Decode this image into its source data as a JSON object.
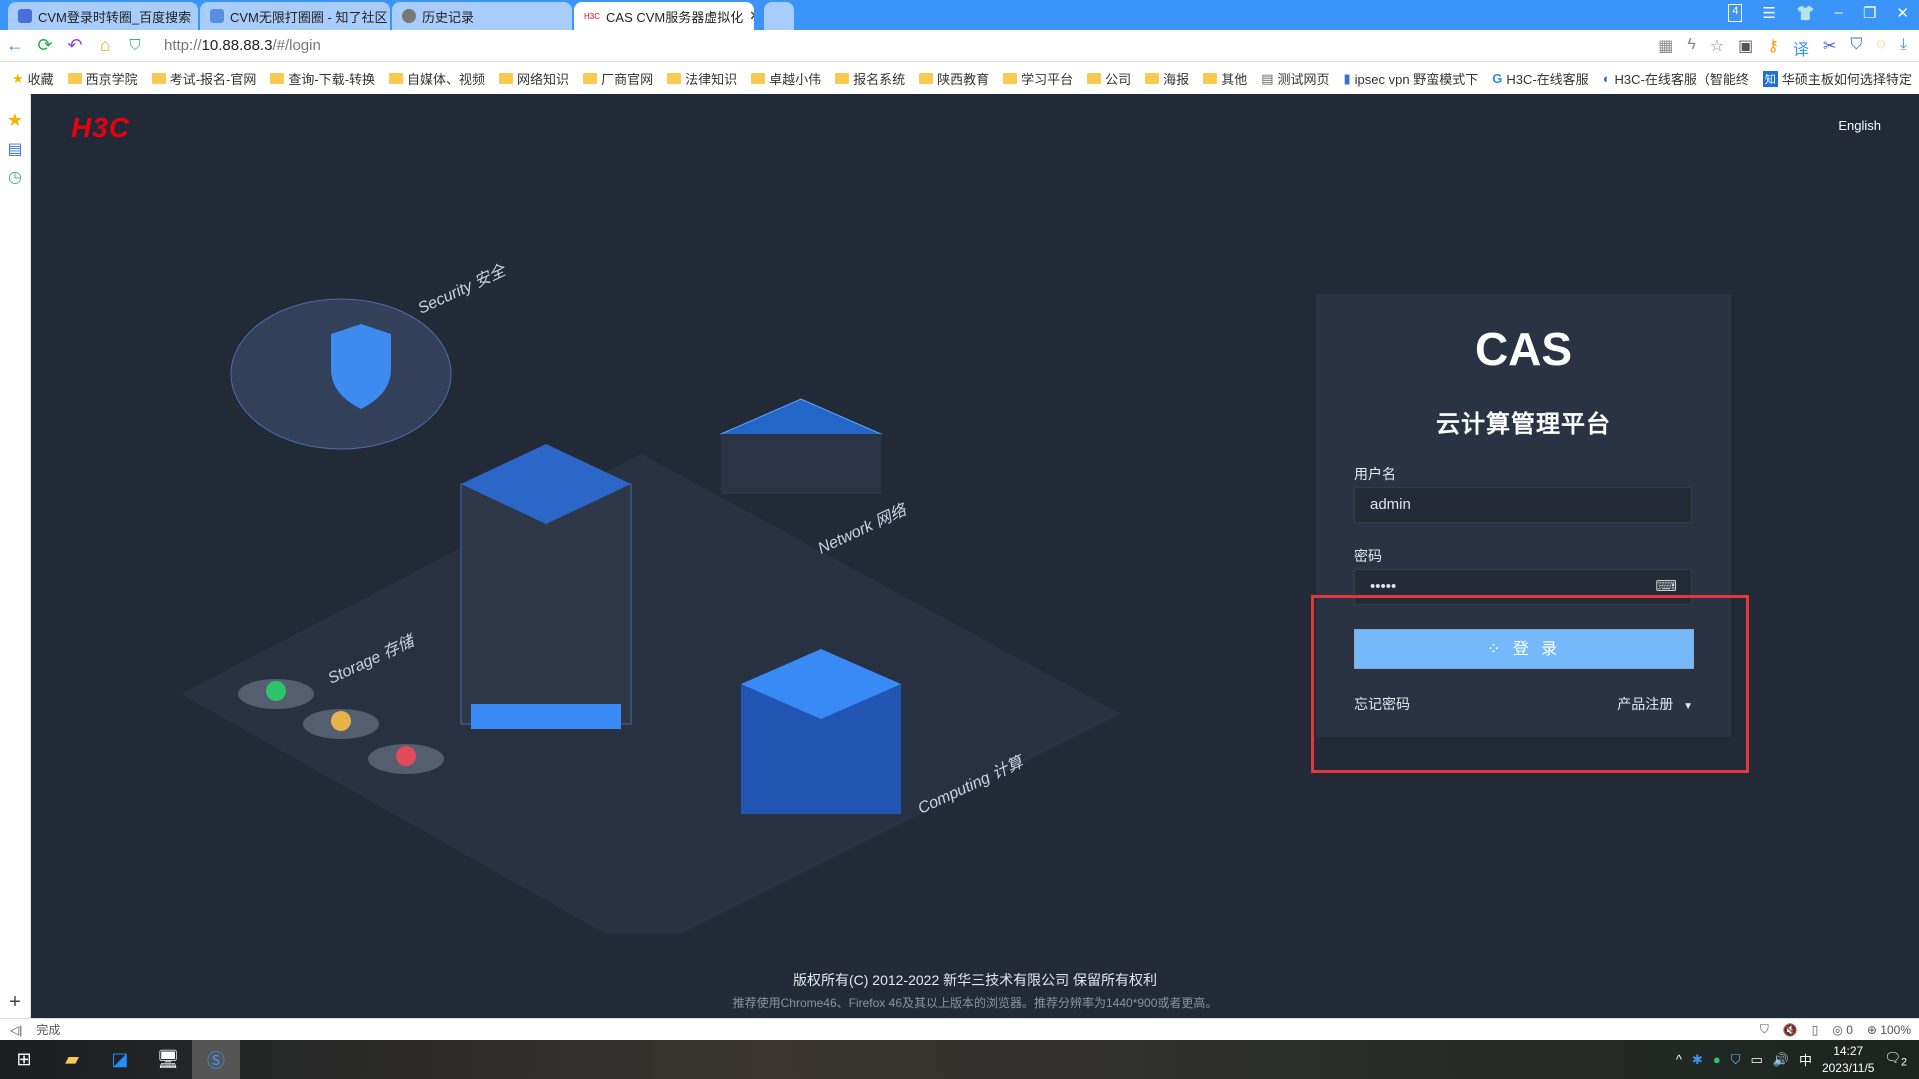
{
  "browser": {
    "tabs": [
      {
        "label": "CVM登录时转圈_百度搜索"
      },
      {
        "label": "CVM无限打圈圈 - 知了社区"
      },
      {
        "label": "历史记录"
      },
      {
        "label": "CAS CVM服务器虚拟化",
        "active": true
      }
    ],
    "tab_count": "4",
    "url_prefix": "http://",
    "url_host": "10.88.88.3",
    "url_path": "/#/login",
    "bookmarks": [
      "收藏",
      "西京学院",
      "考试-报名-官网",
      "查询-下载-转换",
      "自媒体、视频",
      "网络知识",
      "厂商官网",
      "法律知识",
      "卓越小伟",
      "报名系统",
      "陕西教育",
      "学习平台",
      "公司",
      "海报",
      "其他",
      "测试网页",
      "ipsec vpn 野蛮模式下",
      "H3C-在线客服",
      "H3C-在线客服（智能终",
      "华硕主板如何选择特定"
    ],
    "status_text": "完成",
    "status_count": "0",
    "zoom": "100%"
  },
  "page": {
    "logo": "H3C",
    "language_link": "English",
    "illustration_labels": [
      "Security 安全",
      "Network 网络",
      "Storage 存储",
      "Computing 计算"
    ],
    "login": {
      "product_logo": "CAS",
      "product_title": "云计算管理平台",
      "username_label": "用户名",
      "username_value": "admin",
      "password_label": "密码",
      "password_value": "•••••",
      "login_button": "登 录",
      "forgot_password": "忘记密码",
      "product_register": "产品注册"
    },
    "footer": {
      "copyright": "版权所有(C) 2012-2022 新华三技术有限公司 保留所有权利",
      "browser_hint": "推荐使用Chrome46、Firefox 46及其以上版本的浏览器。推荐分辨率为1440*900或者更高。"
    }
  },
  "taskbar": {
    "time": "14:27",
    "date": "2023/11/5",
    "ime": "中",
    "notifications": "2"
  },
  "colors": {
    "accent": "#3b95f8",
    "page_bg": "#222a38",
    "panel_bg": "#2a3344",
    "login_button": "#75b9fb",
    "highlight_box": "#e2383c",
    "brand_red": "#e60012"
  }
}
